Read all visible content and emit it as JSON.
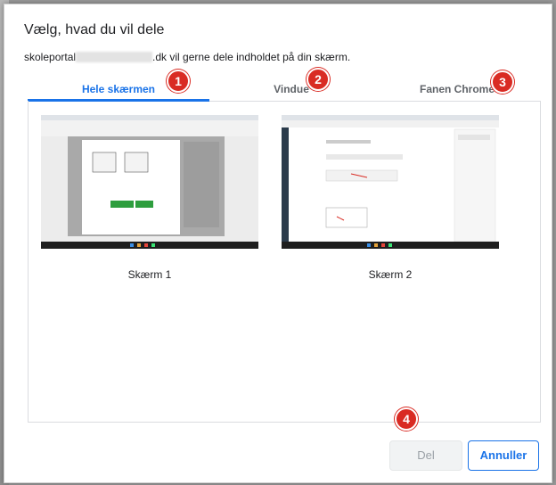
{
  "dialog": {
    "title": "Vælg, hvad du vil dele",
    "description_prefix": "skoleportal",
    "description_suffix": ".dk vil gerne dele indholdet på din skærm."
  },
  "tabs": [
    {
      "label": "Hele skærmen",
      "badge": "1",
      "active": true
    },
    {
      "label": "Vindue",
      "badge": "2",
      "active": false
    },
    {
      "label": "Fanen Chrome",
      "badge": "3",
      "active": false
    }
  ],
  "screens": [
    {
      "label": "Skærm 1"
    },
    {
      "label": "Skærm 2"
    }
  ],
  "buttons": {
    "share_label": "Del",
    "share_badge": "4",
    "cancel_label": "Annuller"
  },
  "colors": {
    "accent": "#1a73e8",
    "badge": "#d92b23"
  }
}
